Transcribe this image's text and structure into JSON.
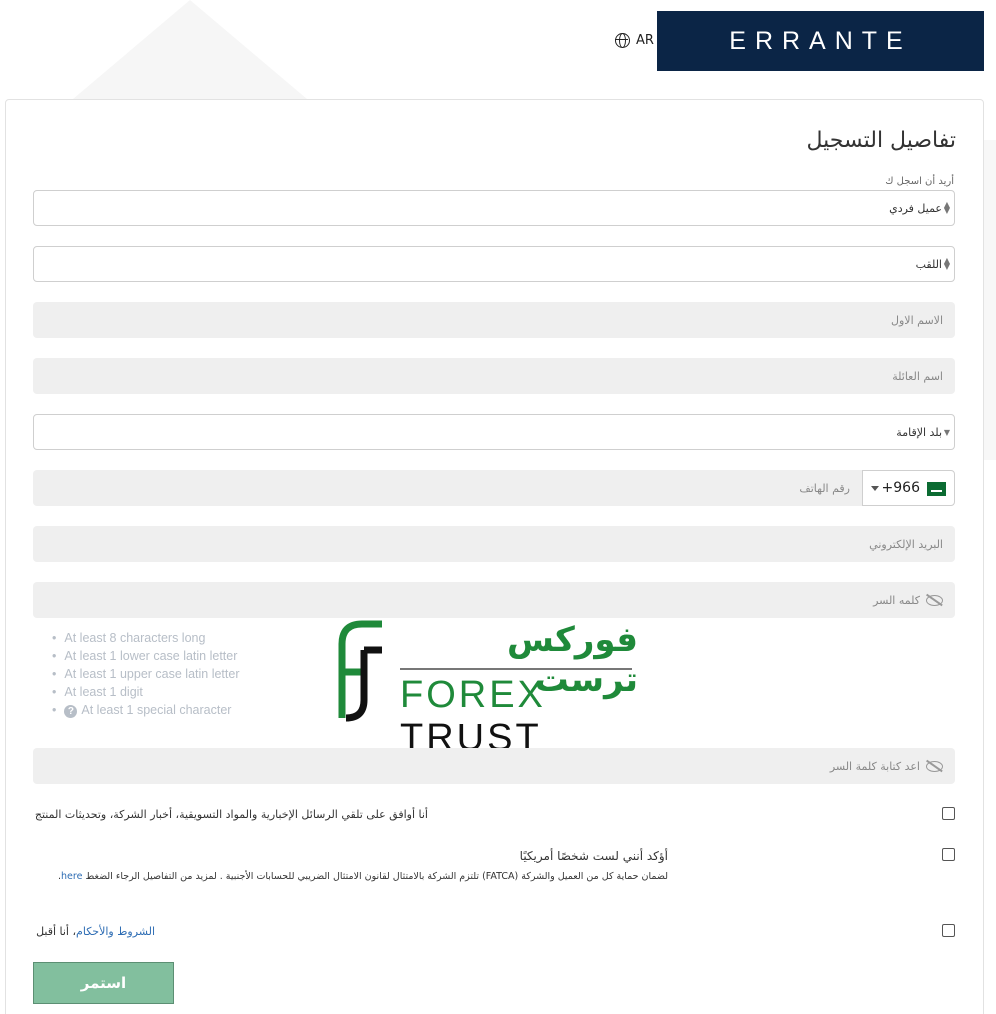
{
  "header": {
    "language_code": "AR",
    "brand": "ERRANTE"
  },
  "form": {
    "title": "تفاصيل التسجيل",
    "register_as_label": "أريد أن اسجل ك",
    "account_type_value": "عميل فردي",
    "salutation_value": "اللقب",
    "first_name_placeholder": "الاسم الاول",
    "last_name_placeholder": "اسم العائلة",
    "country_value": "بلد الإقامة",
    "phone": {
      "dial_code": "+966",
      "placeholder": "رقم الهاتف"
    },
    "email_placeholder": "البريد الإلكتروني",
    "password_placeholder": "كلمه السر",
    "password_rules": [
      "At least 8 characters long",
      "At least 1 lower case latin letter",
      "At least 1 upper case latin letter",
      "At least 1 digit",
      "At least 1 special character"
    ],
    "confirm_password_placeholder": "اعد كتابة كلمة السر",
    "consent_marketing": "أنا أوافق على تلقي الرسائل الإخبارية والمواد التسويقية، أخبار الشركة، وتحديثات المنتج",
    "consent_us_title": "أؤكد أنني لست شخصًا أمريكيًا",
    "consent_us_note": "لضمان حماية كل من العميل والشركة (FATCA) تلتزم الشركة بالامتثال لقانون الامتثال الضريبي للحسابات الأجنبية . لمزيد من التفاصيل الرجاء الضغط",
    "consent_us_link": "here",
    "terms_link": "الشروط والأحكام",
    "terms_suffix": "أنا أقبل",
    "submit_label": "استمر"
  },
  "watermark": {
    "arabic": "فوركس ترست",
    "english_a": "FOREX",
    "english_b": "TRUST"
  },
  "colors": {
    "brand_navy": "#0b2546",
    "accent_red": "#d72c3a",
    "button_green": "#82bf9e",
    "watermark_green": "#1f8a3a"
  }
}
